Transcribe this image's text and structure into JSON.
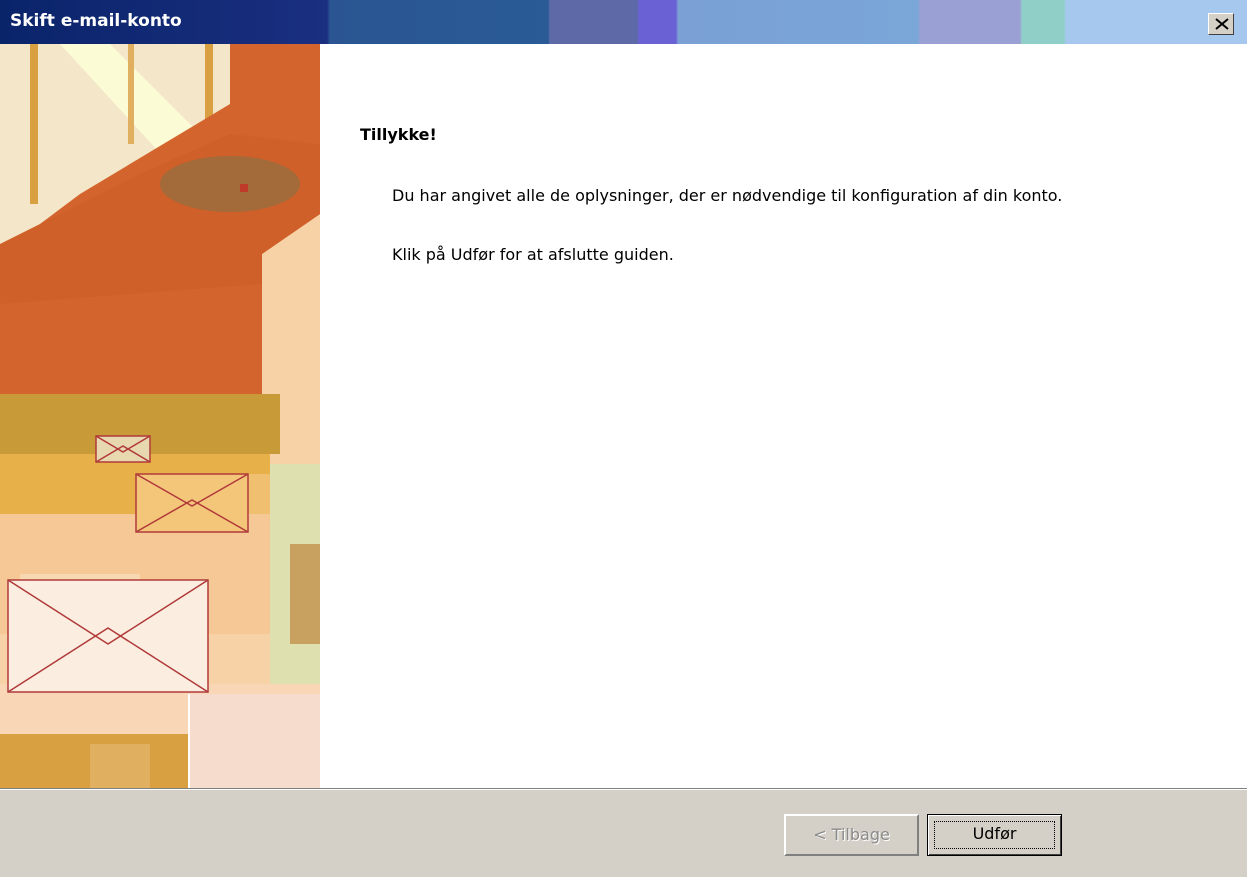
{
  "window": {
    "title": "Skift e-mail-konto",
    "close_icon": "close-icon"
  },
  "content": {
    "heading": "Tillykke!",
    "paragraph1": "Du har angivet alle de oplysninger, der er nødvendige til konfiguration af din konto.",
    "paragraph2": "Klik på Udfør for at afslutte guiden."
  },
  "buttons": {
    "back_label": "< Tilbage",
    "back_enabled": false,
    "finish_label": "Udfør"
  },
  "banner": {
    "image": "envelopes-illustration",
    "colors": [
      "#d0642c",
      "#e8b048",
      "#f6c896",
      "#ffffe0",
      "#c9a03a"
    ]
  }
}
